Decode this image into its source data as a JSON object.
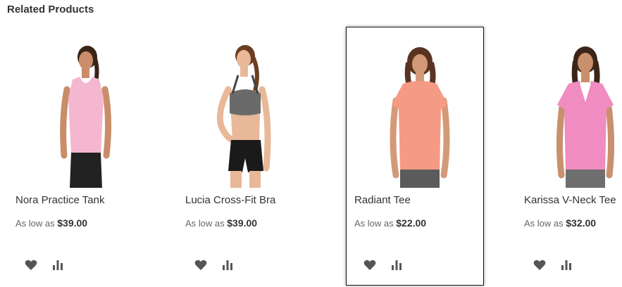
{
  "section": {
    "title": "Related Products"
  },
  "products": [
    {
      "name": "Nora Practice Tank",
      "price_prefix": "As low as",
      "price": "$39.00",
      "top_color": "#f5b7cf",
      "bottom_color": "#222222"
    },
    {
      "name": "Lucia Cross-Fit Bra",
      "price_prefix": "As low as",
      "price": "$39.00",
      "top_color": "#6a6a6a",
      "bottom_color": "#1a1a1a"
    },
    {
      "name": "Radiant Tee",
      "price_prefix": "As low as",
      "price": "$22.00",
      "top_color": "#f59a85",
      "bottom_color": "#5b5b5b"
    },
    {
      "name": "Karissa V-Neck Tee",
      "price_prefix": "As low as",
      "price": "$32.00",
      "top_color": "#f08cbf",
      "bottom_color": "#6e6e6e"
    }
  ],
  "icons": {
    "wishlist": "heart-icon",
    "compare": "compare-icon",
    "icon_color": "#555555"
  }
}
